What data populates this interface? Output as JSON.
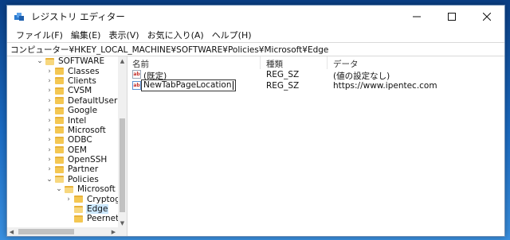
{
  "window": {
    "title": "レジストリ エディター"
  },
  "menu": [
    "ファイル(F)",
    "編集(E)",
    "表示(V)",
    "お気に入り(A)",
    "ヘルプ(H)"
  ],
  "address": "コンピューター¥HKEY_LOCAL_MACHINE¥SOFTWARE¥Policies¥Microsoft¥Edge",
  "tree": [
    {
      "label": "SOFTWARE",
      "chevron": "v"
    },
    {
      "label": "Classes",
      "chevron": ">"
    },
    {
      "label": "Clients",
      "chevron": ">"
    },
    {
      "label": "CVSM",
      "chevron": ">"
    },
    {
      "label": "DefaultUserEnvironn",
      "chevron": ">"
    },
    {
      "label": "Google",
      "chevron": ">"
    },
    {
      "label": "Intel",
      "chevron": ">"
    },
    {
      "label": "Microsoft",
      "chevron": ">"
    },
    {
      "label": "ODBC",
      "chevron": ">"
    },
    {
      "label": "OEM",
      "chevron": ">"
    },
    {
      "label": "OpenSSH",
      "chevron": ">"
    },
    {
      "label": "Partner",
      "chevron": ">"
    },
    {
      "label": "Policies",
      "chevron": "v"
    },
    {
      "label": "Microsoft",
      "chevron": "v"
    },
    {
      "label": "Cryptography",
      "chevron": ">"
    },
    {
      "label": "Edge",
      "chevron": ""
    },
    {
      "label": "Peernet",
      "chevron": ""
    }
  ],
  "columns": {
    "name": "名前",
    "type": "種類",
    "data": "データ"
  },
  "values": [
    {
      "name": "(既定)",
      "type": "REG_SZ",
      "data": "(値の設定なし)",
      "icon": "ab-icon",
      "editing": false
    },
    {
      "name": "NewTabPageLocation",
      "type": "REG_SZ",
      "data": "https://www.ipentec.com",
      "icon": "ab-icon",
      "editing": true
    }
  ],
  "colors": {
    "selection": "#cce8ff",
    "folder": "#f4c752"
  }
}
